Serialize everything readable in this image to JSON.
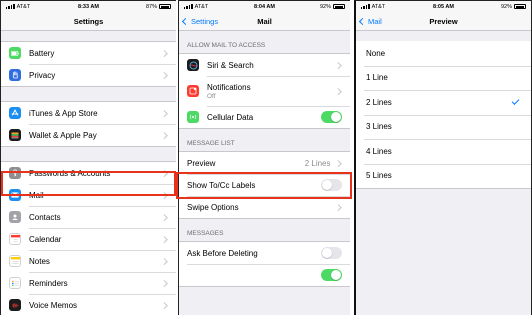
{
  "status": {
    "carrier": "AT&T",
    "battery": "87%",
    "battery2": "92%",
    "time1": "8:33 AM",
    "time2": "8:04 AM",
    "time3": "8:05 AM"
  },
  "panel1": {
    "title": "Settings",
    "rows": [
      {
        "label": "Battery",
        "icon": "battery-icon",
        "color": "#4cd964"
      },
      {
        "label": "Privacy",
        "icon": "hand-icon",
        "color": "#2f6de1"
      },
      {
        "label": "iTunes & App Store",
        "icon": "app-store-icon",
        "color": "#1b8ef2"
      },
      {
        "label": "Wallet & Apple Pay",
        "icon": "wallet-icon",
        "color": "#1c1c1e"
      },
      {
        "label": "Passwords & Accounts",
        "icon": "key-icon",
        "color": "#8e8e93"
      },
      {
        "label": "Mail",
        "icon": "mail-icon",
        "color": "#1b8ef2"
      },
      {
        "label": "Contacts",
        "icon": "contacts-icon",
        "color": "#a2a2a7"
      },
      {
        "label": "Calendar",
        "icon": "calendar-icon",
        "color": "#ffffff"
      },
      {
        "label": "Notes",
        "icon": "notes-icon",
        "color": "#ffffff"
      },
      {
        "label": "Reminders",
        "icon": "reminders-icon",
        "color": "#ffffff"
      },
      {
        "label": "Voice Memos",
        "icon": "voice-memos-icon",
        "color": "#1c1c1e"
      }
    ]
  },
  "panel2": {
    "back": "Settings",
    "title": "Mail",
    "section1": "ALLOW MAIL TO ACCESS",
    "siri": "Siri & Search",
    "notifications": "Notifications",
    "notifications_sub": "Off",
    "cellular": "Cellular Data",
    "cellular_on": true,
    "section2": "MESSAGE LIST",
    "preview": "Preview",
    "preview_value": "2 Lines",
    "show_tocc": "Show To/Cc Labels",
    "show_tocc_on": false,
    "swipe": "Swipe Options",
    "section3": "MESSAGES",
    "ask_delete": "Ask Before Deleting",
    "ask_delete_on": false
  },
  "panel3": {
    "back": "Mail",
    "title": "Preview",
    "options": [
      "None",
      "1 Line",
      "2 Lines",
      "3 Lines",
      "4 Lines",
      "5 Lines"
    ],
    "selected_index": 2
  },
  "colors": {
    "accent": "#007aff",
    "highlight": "#e8331c",
    "toggle_on": "#4cd964"
  }
}
